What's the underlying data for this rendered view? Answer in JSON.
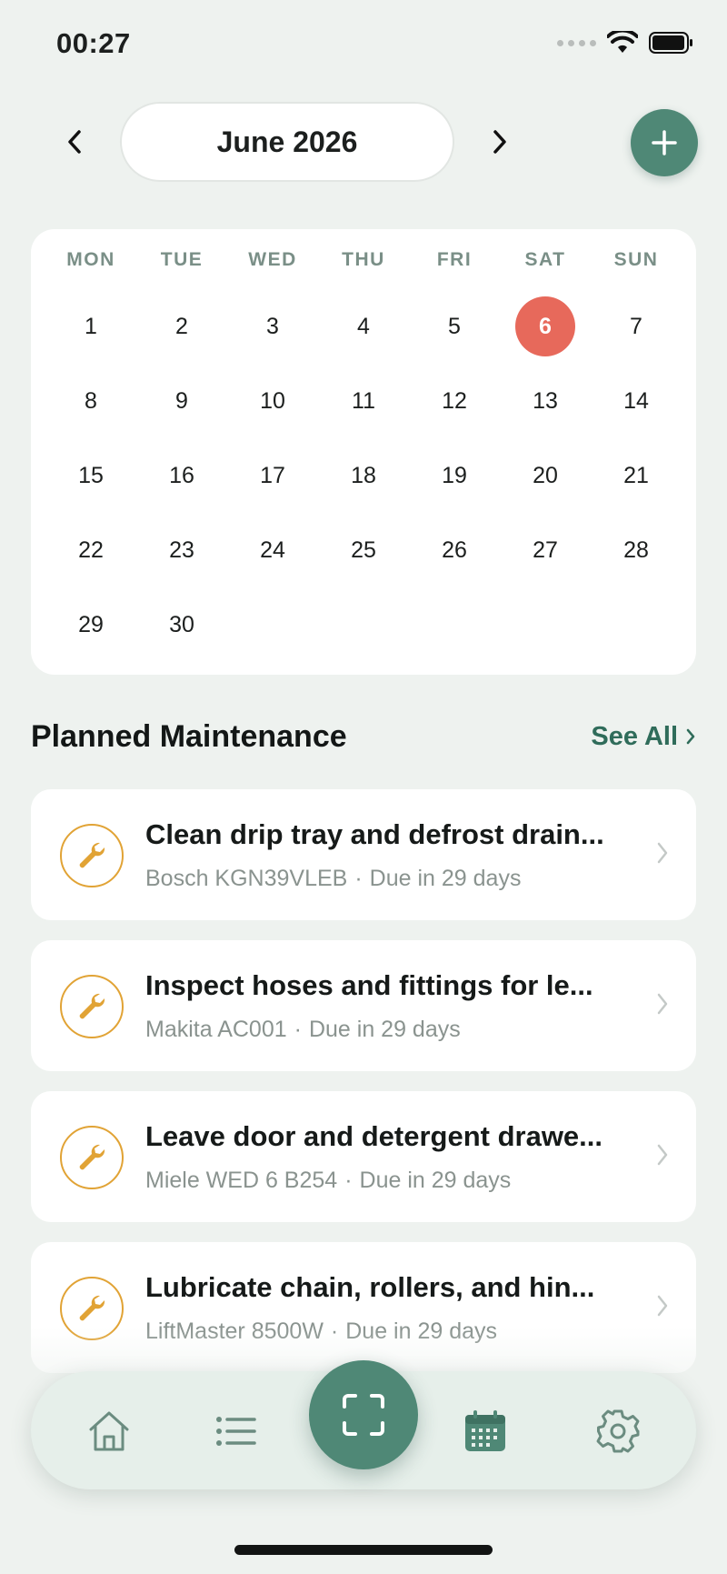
{
  "status_bar": {
    "time": "00:27"
  },
  "header": {
    "month": "June 2026"
  },
  "calendar": {
    "weekdays": [
      "MON",
      "TUE",
      "WED",
      "THU",
      "FRI",
      "SAT",
      "SUN"
    ],
    "days": [
      "1",
      "2",
      "3",
      "4",
      "5",
      "6",
      "7",
      "8",
      "9",
      "10",
      "11",
      "12",
      "13",
      "14",
      "15",
      "16",
      "17",
      "18",
      "19",
      "20",
      "21",
      "22",
      "23",
      "24",
      "25",
      "26",
      "27",
      "28",
      "29",
      "30"
    ],
    "today": "6"
  },
  "section": {
    "title": "Planned Maintenance",
    "see_all": "See All"
  },
  "tasks": [
    {
      "title": "Clean drip tray and defrost drain...",
      "device": "Bosch KGN39VLEB",
      "due": "Due in 29 days"
    },
    {
      "title": "Inspect hoses and fittings for le...",
      "device": "Makita AC001",
      "due": "Due in 29 days"
    },
    {
      "title": "Leave door and detergent drawe...",
      "device": "Miele WED 6 B254",
      "due": "Due in 29 days"
    },
    {
      "title": "Lubricate chain, rollers, and hin...",
      "device": "LiftMaster 8500W",
      "due": "Due in 29 days"
    }
  ],
  "colors": {
    "accent": "#4f8876",
    "today": "#e7695b",
    "wrench": "#e1a335",
    "link": "#2f6c5a"
  },
  "tab_bar": {
    "items": [
      "house-icon",
      "list-icon",
      "scan-icon",
      "calendar-icon",
      "gear-icon"
    ],
    "active": "calendar-icon"
  }
}
